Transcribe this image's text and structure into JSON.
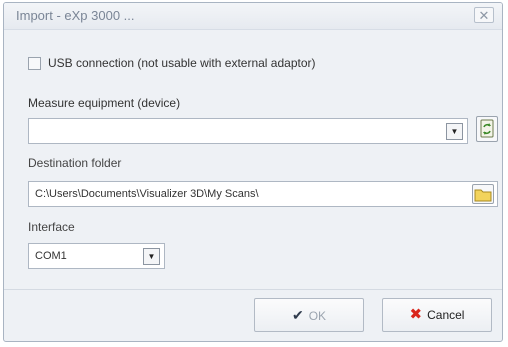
{
  "window": {
    "title": "Import - eXp 3000 ...",
    "close_glyph": "✕"
  },
  "usb": {
    "label": "USB connection (not usable with external adaptor)",
    "checked": false
  },
  "device": {
    "label": "Measure equipment (device)",
    "value": ""
  },
  "destination": {
    "label": "Destination folder",
    "value": "C:\\Users\\Documents\\Visualizer 3D\\My Scans\\"
  },
  "interface": {
    "label": "Interface",
    "value": "COM1"
  },
  "buttons": {
    "ok": "OK",
    "cancel": "Cancel"
  },
  "icons": {
    "dropdown": "▼",
    "check": "✔",
    "cross": "✖",
    "refresh": "refresh-icon",
    "folder": "folder-icon"
  },
  "colors": {
    "cancel_icon": "#d9261c",
    "ok_icon": "#2f3b4c"
  }
}
